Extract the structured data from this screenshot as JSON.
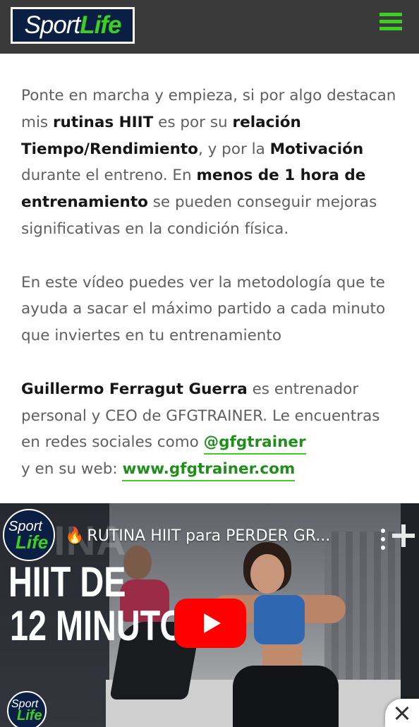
{
  "header": {
    "logo": {
      "part1": "Sport",
      "part2": "Life"
    },
    "menu_icon": "hamburger-menu-icon",
    "accent_color": "#3ecf25",
    "background_color": "#3a3a3a"
  },
  "article": {
    "paragraph1": [
      {
        "text": "Ponte en marcha y empieza, si por algo destacan mis ",
        "bold": false
      },
      {
        "text": "rutinas HIIT",
        "bold": true
      },
      {
        "text": " es por su ",
        "bold": false
      },
      {
        "text": "relación Tiempo/Rendimiento",
        "bold": true
      },
      {
        "text": ", y por la ",
        "bold": false
      },
      {
        "text": "Motivación",
        "bold": true
      },
      {
        "text": " durante el entreno. En ",
        "bold": false
      },
      {
        "text": "menos de 1 hora de entrenamiento",
        "bold": true
      },
      {
        "text": " se pueden conseguir mejoras significativas en la condición física.",
        "bold": false
      }
    ],
    "paragraph2": "En este vídeo puedes ver la metodología que te ayuda a sacar el máximo partido a cada minuto que inviertes en tu entrenamiento",
    "paragraph3": {
      "author": "Guillermo Ferragut Guerra",
      "text1": " es entrenador personal y CEO de GFGTRAINER. Le encuentras en redes sociales como ",
      "social_link": "@gfgtrainer",
      "text2": " y en su web: ",
      "web_link": "www.gfgtrainer.com"
    }
  },
  "video": {
    "channel_logo": {
      "part1": "Sport",
      "part2": "Life"
    },
    "title_icon": "fire-icon",
    "title": "RUTINA HIIT para PERDER GR...",
    "thumbnail_bg_text": "TINA",
    "thumbnail_text_line1": "HIIT DE",
    "thumbnail_text_line2": "12 MINUTOS",
    "play_icon": "play-icon",
    "watermark": {
      "part1": "Sport",
      "part2": "Life"
    }
  },
  "ad": {
    "close_icon": "close-icon"
  }
}
